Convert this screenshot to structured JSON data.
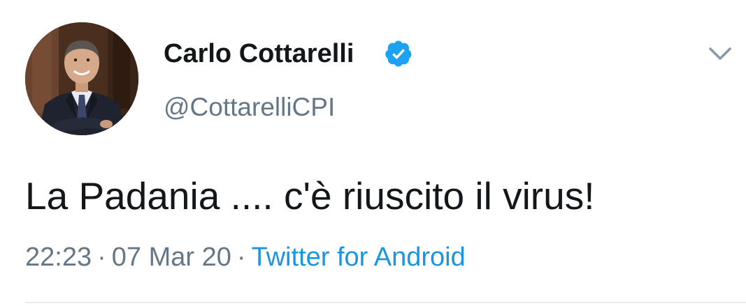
{
  "user": {
    "display_name": "Carlo Cottarelli",
    "handle": "@CottarelliCPI",
    "verified": true,
    "verified_color": "#1da1f2",
    "avatar_icon": "profile-photo"
  },
  "tweet": {
    "text": "La Padania .... c'è riuscito il virus!"
  },
  "meta": {
    "time": "22:23",
    "separator": "·",
    "date": "07 Mar 20",
    "source": "Twitter for Android",
    "source_color": "#1b95e0"
  },
  "menu": {
    "icon": "chevron-down-icon"
  }
}
